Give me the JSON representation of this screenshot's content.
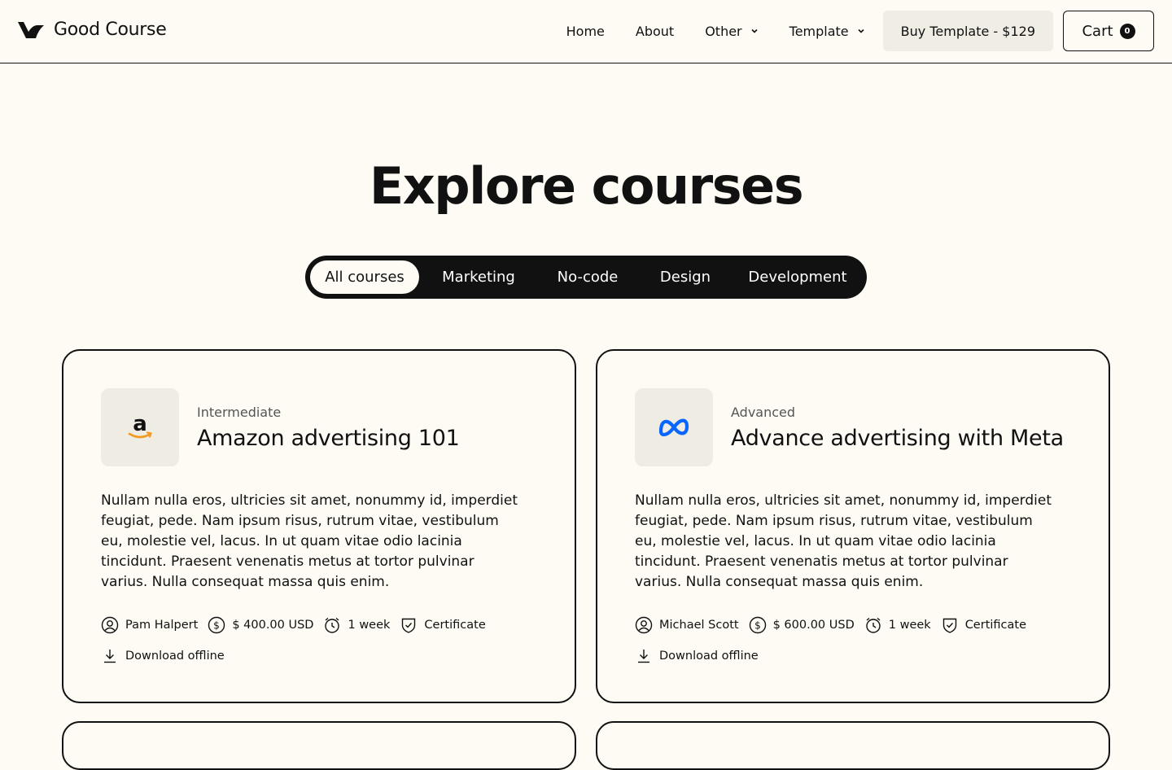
{
  "header": {
    "brand": "Good Course",
    "nav": [
      {
        "label": "Home"
      },
      {
        "label": "About"
      },
      {
        "label": "Other",
        "dropdown": true
      },
      {
        "label": "Template",
        "dropdown": true
      }
    ],
    "buy_label": "Buy Template - $129",
    "cart_label": "Cart",
    "cart_count": "0"
  },
  "main": {
    "title": "Explore courses",
    "tabs": [
      {
        "label": "All courses",
        "active": true
      },
      {
        "label": "Marketing"
      },
      {
        "label": "No-code"
      },
      {
        "label": "Design"
      },
      {
        "label": "Development"
      }
    ]
  },
  "courses": [
    {
      "logo": "amazon-logo",
      "level": "Intermediate",
      "title": "Amazon advertising 101",
      "description": "Nullam nulla eros, ultricies sit amet, nonummy id, imperdiet feugiat, pede. Nam ipsum risus, rutrum vitae, vestibulum eu, molestie vel, lacus. In ut quam vitae odio lacinia tincidunt. Praesent venenatis metus at tortor pulvinar varius. Nulla consequat massa quis enim.",
      "instructor": "Pam Halpert",
      "price": "$ 400.00 USD",
      "duration": "1 week",
      "certificate": "Certificate",
      "download": "Download offline"
    },
    {
      "logo": "meta-logo",
      "level": "Advanced",
      "title": "Advance advertising with Meta",
      "description": "Nullam nulla eros, ultricies sit amet, nonummy id, imperdiet feugiat, pede. Nam ipsum risus, rutrum vitae, vestibulum eu, molestie vel, lacus. In ut quam vitae odio lacinia tincidunt. Praesent venenatis metus at tortor pulvinar varius. Nulla consequat massa quis enim.",
      "instructor": "Michael Scott",
      "price": "$ 600.00 USD",
      "duration": "1 week",
      "certificate": "Certificate",
      "download": "Download offline"
    }
  ],
  "colors": {
    "background": "#fdfbf3",
    "ink": "#111111",
    "chip": "#f0ede4",
    "meta_blue": "#0866ff",
    "amazon_orange": "#f29a1f"
  }
}
